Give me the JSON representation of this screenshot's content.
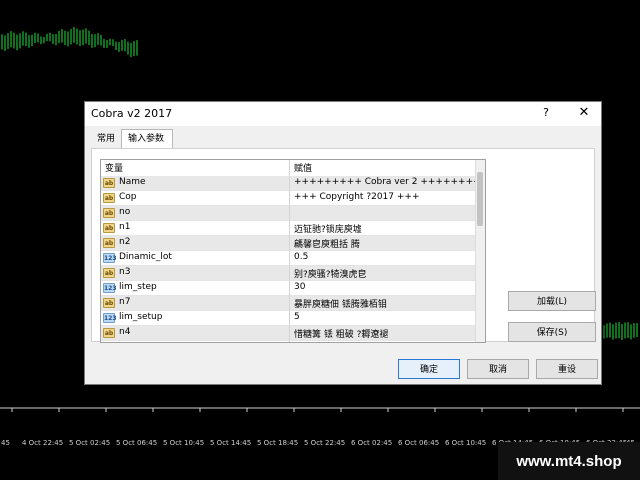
{
  "chart": {
    "axis_labels": [
      "4 Oct 22:45",
      "5 Oct 02:45",
      "5 Oct 06:45",
      "5 Oct 10:45",
      "5 Oct 14:45",
      "5 Oct 18:45",
      "5 Oct 22:45",
      "6 Oct 02:45",
      "6 Oct 06:45",
      "6 Oct 10:45",
      "6 Oct 14:45",
      "6 Oct 18:45",
      "6 Oct 22:45"
    ],
    "axis_label_left": "45",
    "axis_label_right": "45",
    "candle_color": "#22e03a"
  },
  "watermark": "www.mt4.shop",
  "dialog": {
    "title": "Cobra v2 2017",
    "help": "?",
    "close": "✕",
    "tabs": [
      {
        "label": "常用"
      },
      {
        "label": "输入参数"
      }
    ],
    "columns": {
      "variable": "变量",
      "value": "赋值"
    },
    "rows": [
      {
        "type": "ab",
        "name": "Name",
        "value": "+++++++++ Cobra ver 2 +++++++++"
      },
      {
        "type": "ab",
        "name": "Cop",
        "value": "+++ Copyright ?2017 +++"
      },
      {
        "type": "ab",
        "name": "no",
        "value": ""
      },
      {
        "type": "ab",
        "name": "n1",
        "value": "迈钲驰?锁庑庾墟"
      },
      {
        "type": "ab",
        "name": "n2",
        "value": "騗馨皀庾粗括 腾"
      },
      {
        "type": "123",
        "name": "Dinamic_lot",
        "value": "0.5"
      },
      {
        "type": "ab",
        "name": "n3",
        "value": "别?庾骚?犄溴虎皀"
      },
      {
        "type": "123",
        "name": "lim_step",
        "value": "30"
      },
      {
        "type": "ab",
        "name": "n7",
        "value": "暴胖庾糖佃 铥腾雅栢钼"
      },
      {
        "type": "123",
        "name": "lim_setup",
        "value": "5"
      },
      {
        "type": "ab",
        "name": "n4",
        "value": "惜糖篝 铥 粗破        ?耨遼褪"
      }
    ],
    "load_button": "加载(L)",
    "save_button": "保存(S)",
    "ok_button": "确定",
    "cancel_button": "取消",
    "reset_button": "重设"
  }
}
